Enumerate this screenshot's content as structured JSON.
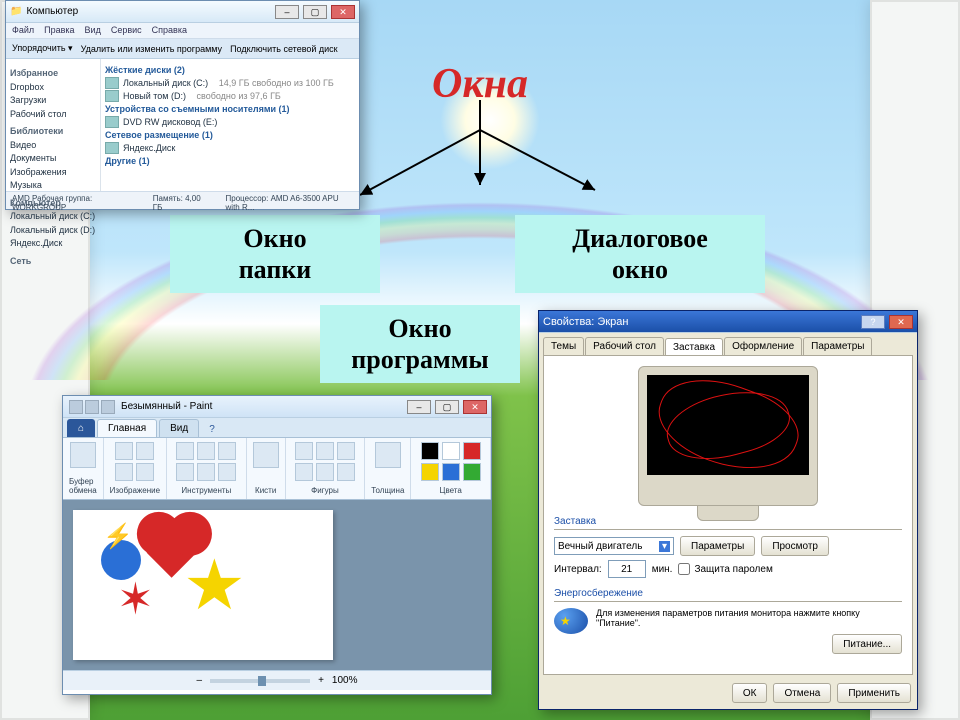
{
  "title": "Окна",
  "concepts": {
    "folder": "Окно\nпапки",
    "program": "Окно\nпрограммы",
    "dialog": "Диалоговое\nокно"
  },
  "explorer": {
    "title": "Компьютер",
    "menu": [
      "Файл",
      "Правка",
      "Вид",
      "Сервис",
      "Справка"
    ],
    "toolbar": {
      "organize": "Упорядочить ▾",
      "uninstall": "Удалить или изменить программу",
      "connect": "Подключить сетевой диск"
    },
    "nav": {
      "fav": "Избранное",
      "fav_items": [
        "Dropbox",
        "Загрузки",
        "Рабочий стол"
      ],
      "lib": "Библиотеки",
      "lib_items": [
        "Видео",
        "Документы",
        "Изображения",
        "Музыка"
      ],
      "comp": "Компьютер",
      "comp_items": [
        "Локальный диск (C:)",
        "Локальный диск (D:)",
        "Яндекс.Диск"
      ],
      "net": "Сеть"
    },
    "content": {
      "hdd_header": "Жёсткие диски (2)",
      "hdd": [
        {
          "name": "Локальный диск (C:)",
          "free": "14,9 ГБ свободно из 100 ГБ"
        },
        {
          "name": "Новый том (D:)",
          "free": "свободно из 97,6 ГБ"
        }
      ],
      "removable_header": "Устройства со съемными носителями (1)",
      "removable": "DVD RW дисковод (E:)",
      "net_header": "Сетевое размещение (1)",
      "net_item": "Яндекс.Диск",
      "other_header": "Другие (1)"
    },
    "status": {
      "workgroup_label": "AMD  Рабочая группа:",
      "workgroup": "WORKGROUP",
      "mem_label": "Память:",
      "mem": "4,00 ГБ",
      "cpu_label": "Процессор:",
      "cpu": "AMD A6-3500 APU with R..."
    }
  },
  "paint": {
    "title_prefix": "Безымянный - Paint",
    "tabs": {
      "file": "⌂",
      "home": "Главная",
      "view": "Вид"
    },
    "groups": {
      "clipboard": "Буфер\nобмена",
      "image": "Изображение",
      "tools": "Инструменты",
      "brushes": "Кисти",
      "shapes": "Фигуры",
      "size": "Толщина",
      "colors": "Цвета"
    },
    "zoom": "100%"
  },
  "dialog": {
    "title": "Свойства: Экран",
    "tabs": [
      "Темы",
      "Рабочий стол",
      "Заставка",
      "Оформление",
      "Параметры"
    ],
    "active_tab": 2,
    "section_screensaver": "Заставка",
    "screensaver_value": "Вечный двигатель",
    "btn_params": "Параметры",
    "btn_preview": "Просмотр",
    "interval_label": "Интервал:",
    "interval_value": "21",
    "interval_unit": "мин.",
    "protect_label": "Защита паролем",
    "section_power": "Энергосбережение",
    "power_text": "Для изменения параметров питания монитора нажмите кнопку \"Питание\".",
    "btn_power": "Питание...",
    "ok": "ОК",
    "cancel": "Отмена",
    "apply": "Применить"
  }
}
